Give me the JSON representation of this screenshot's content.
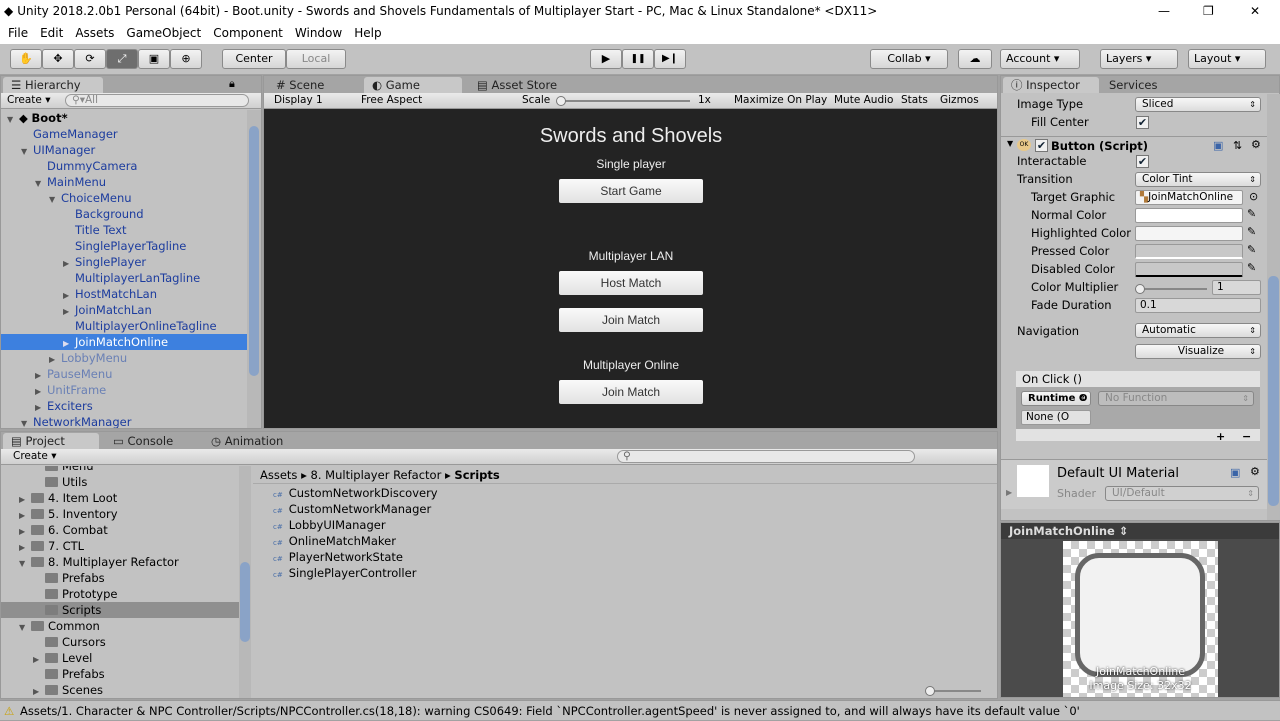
{
  "window": {
    "title": "Unity 2018.2.0b1 Personal (64bit) - Boot.unity - Swords and Shovels Fundamentals of Multiplayer Start - PC, Mac & Linux Standalone* <DX11>",
    "min": "—",
    "max": "❐",
    "close": "✕"
  },
  "menu": [
    "File",
    "Edit",
    "Assets",
    "GameObject",
    "Component",
    "Window",
    "Help"
  ],
  "toolbar": {
    "tools": [
      "hand-icon",
      "move-icon",
      "rotate-icon",
      "scale-icon",
      "rect-icon",
      "transform-icon"
    ],
    "tool_glyphs": [
      "✋",
      "✥",
      "⟳",
      "⤢",
      "▣",
      "⊕"
    ],
    "center": "Center",
    "local": "Local",
    "play": "▶",
    "pause": "❚❚",
    "step": "▶❙",
    "collab": "Collab ▾",
    "cloud": "☁",
    "account": "Account",
    "layers": "Layers",
    "layout": "Layout"
  },
  "hierarchy": {
    "tab": "Hierarchy",
    "create": "Create",
    "search": "All",
    "items": [
      {
        "label": "Boot*",
        "depth": 0,
        "arrow": "▼",
        "style": "scene"
      },
      {
        "label": "GameManager",
        "depth": 1,
        "arrow": "",
        "style": "pref"
      },
      {
        "label": "UIManager",
        "depth": 1,
        "arrow": "▼",
        "style": "pref"
      },
      {
        "label": "DummyCamera",
        "depth": 2,
        "arrow": "",
        "style": "pref"
      },
      {
        "label": "MainMenu",
        "depth": 2,
        "arrow": "▼",
        "style": "pref"
      },
      {
        "label": "ChoiceMenu",
        "depth": 3,
        "arrow": "▼",
        "style": "pref"
      },
      {
        "label": "Background",
        "depth": 4,
        "arrow": "",
        "style": "pref"
      },
      {
        "label": "Title Text",
        "depth": 4,
        "arrow": "",
        "style": "pref"
      },
      {
        "label": "SinglePlayerTagline",
        "depth": 4,
        "arrow": "",
        "style": "pref"
      },
      {
        "label": "SinglePlayer",
        "depth": 4,
        "arrow": "▶",
        "style": "pref"
      },
      {
        "label": "MultiplayerLanTagline",
        "depth": 4,
        "arrow": "",
        "style": "pref"
      },
      {
        "label": "HostMatchLan",
        "depth": 4,
        "arrow": "▶",
        "style": "pref"
      },
      {
        "label": "JoinMatchLan",
        "depth": 4,
        "arrow": "▶",
        "style": "pref"
      },
      {
        "label": "MultiplayerOnlineTagline",
        "depth": 4,
        "arrow": "",
        "style": "pref"
      },
      {
        "label": "JoinMatchOnline",
        "depth": 4,
        "arrow": "▶",
        "style": "pref",
        "selected": true
      },
      {
        "label": "LobbyMenu",
        "depth": 3,
        "arrow": "▶",
        "style": "inact"
      },
      {
        "label": "PauseMenu",
        "depth": 2,
        "arrow": "▶",
        "style": "inact"
      },
      {
        "label": "UnitFrame",
        "depth": 2,
        "arrow": "▶",
        "style": "inact"
      },
      {
        "label": "Exciters",
        "depth": 2,
        "arrow": "▶",
        "style": "pref"
      },
      {
        "label": "NetworkManager",
        "depth": 1,
        "arrow": "▼",
        "style": "pref"
      }
    ]
  },
  "game": {
    "tabs": [
      "Scene",
      "Game",
      "Asset Store"
    ],
    "display": "Display 1",
    "aspect": "Free Aspect",
    "scale_label": "Scale",
    "scale_value": "1x",
    "maximize": "Maximize On Play",
    "mute": "Mute Audio",
    "stats": "Stats",
    "gizmos": "Gizmos",
    "title": "Swords and Shovels",
    "single_label": "Single player",
    "start_game": "Start Game",
    "lan_label": "Multiplayer LAN",
    "host_match": "Host Match",
    "join_match_lan": "Join Match",
    "online_label": "Multiplayer Online",
    "join_match_online": "Join Match"
  },
  "inspector": {
    "tabs": [
      "Inspector",
      "Services"
    ],
    "image_type_label": "Image Type",
    "image_type": "Sliced",
    "fill_center_label": "Fill Center",
    "fill_center": true,
    "component": "Button (Script)",
    "interactable_label": "Interactable",
    "interactable": true,
    "transition_label": "Transition",
    "transition": "Color Tint",
    "target_graphic_label": "Target Graphic",
    "target_graphic": "JoinMatchOnline",
    "normal_color_label": "Normal Color",
    "highlighted_color_label": "Highlighted Color",
    "pressed_color_label": "Pressed Color",
    "disabled_color_label": "Disabled Color",
    "colors": {
      "normal": "#ffffff",
      "highlighted": "#f5f5f5",
      "pressed": "#c8c8c8",
      "disabled": "#c8c8c8"
    },
    "color_multiplier_label": "Color Multiplier",
    "color_multiplier": "1",
    "fade_duration_label": "Fade Duration",
    "fade_duration": "0.1",
    "navigation_label": "Navigation",
    "navigation": "Automatic",
    "visualize": "Visualize",
    "on_click": "On Click ()",
    "runtime": "Runtime O",
    "no_function": "No Function",
    "none_obj": "None (O",
    "plus": "+",
    "minus": "−",
    "material": "Default UI Material",
    "shader_label": "Shader",
    "shader": "UI/Default"
  },
  "preview": {
    "title": "JoinMatchOnline",
    "name": "JoinMatchOnline",
    "size": "Image Size: 32x32"
  },
  "project": {
    "tabs": [
      "Project",
      "Console",
      "Animation"
    ],
    "create": "Create",
    "breadcrumb": [
      "Assets",
      "8. Multiplayer Refactor",
      "Scripts"
    ],
    "tree": [
      {
        "label": "Menu",
        "depth": 2,
        "arrow": ""
      },
      {
        "label": "Utils",
        "depth": 2,
        "arrow": ""
      },
      {
        "label": "4. Item Loot",
        "depth": 1,
        "arrow": "▶"
      },
      {
        "label": "5. Inventory",
        "depth": 1,
        "arrow": "▶"
      },
      {
        "label": "6. Combat",
        "depth": 1,
        "arrow": "▶"
      },
      {
        "label": "7. CTL",
        "depth": 1,
        "arrow": "▶"
      },
      {
        "label": "8. Multiplayer Refactor",
        "depth": 1,
        "arrow": "▼"
      },
      {
        "label": "Prefabs",
        "depth": 2,
        "arrow": ""
      },
      {
        "label": "Prototype",
        "depth": 2,
        "arrow": ""
      },
      {
        "label": "Scripts",
        "depth": 2,
        "arrow": "",
        "selected": true
      },
      {
        "label": "Common",
        "depth": 1,
        "arrow": "▼"
      },
      {
        "label": "Cursors",
        "depth": 2,
        "arrow": ""
      },
      {
        "label": "Level",
        "depth": 2,
        "arrow": "▶"
      },
      {
        "label": "Prefabs",
        "depth": 2,
        "arrow": ""
      },
      {
        "label": "Scenes",
        "depth": 2,
        "arrow": "▶"
      }
    ],
    "files": [
      "CustomNetworkDiscovery",
      "CustomNetworkManager",
      "LobbyUIManager",
      "OnlineMatchMaker",
      "PlayerNetworkState",
      "SinglePlayerController"
    ]
  },
  "status": "Assets/1. Character & NPC Controller/Scripts/NPCController.cs(18,18): warning CS0649: Field `NPCController.agentSpeed' is never assigned to, and will always have its default value `0'"
}
